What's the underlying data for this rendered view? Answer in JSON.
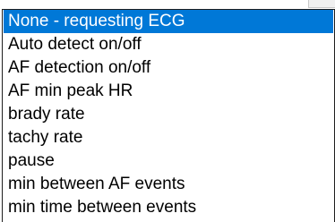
{
  "dropdown": {
    "items": [
      {
        "label": "None - requesting ECG",
        "selected": true
      },
      {
        "label": "Auto detect on/off",
        "selected": false
      },
      {
        "label": "AF detection on/off",
        "selected": false
      },
      {
        "label": "AF min peak HR",
        "selected": false
      },
      {
        "label": "brady rate",
        "selected": false
      },
      {
        "label": "tachy rate",
        "selected": false
      },
      {
        "label": "pause",
        "selected": false
      },
      {
        "label": "min between AF events",
        "selected": false
      },
      {
        "label": "min time between events",
        "selected": false
      }
    ],
    "colors": {
      "highlight_bg": "#0078d7",
      "highlight_text": "#ffffff",
      "text": "#000000",
      "border": "#1e1e1e"
    }
  }
}
